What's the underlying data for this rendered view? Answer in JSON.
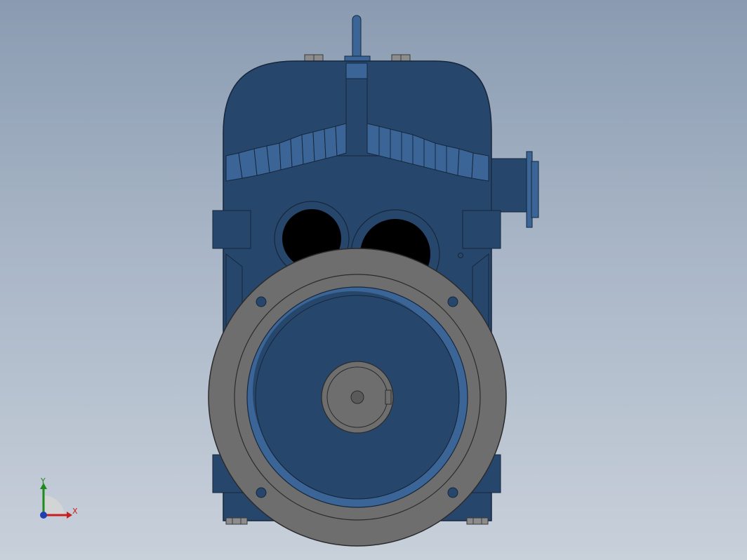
{
  "viewport": {
    "background_top": "#8a9bb1",
    "background_bottom": "#c8d0da"
  },
  "model": {
    "body_color": "#27466b",
    "body_edge_color": "#16263c",
    "fin_color": "#3b6596",
    "flange_color": "#6e6e6e",
    "opening_color": "#000000"
  },
  "triad": {
    "x_label": "X",
    "y_label": "Y",
    "x_color": "#c81e1e",
    "y_color": "#1f8a1f",
    "z_color": "#1f3fb5"
  }
}
